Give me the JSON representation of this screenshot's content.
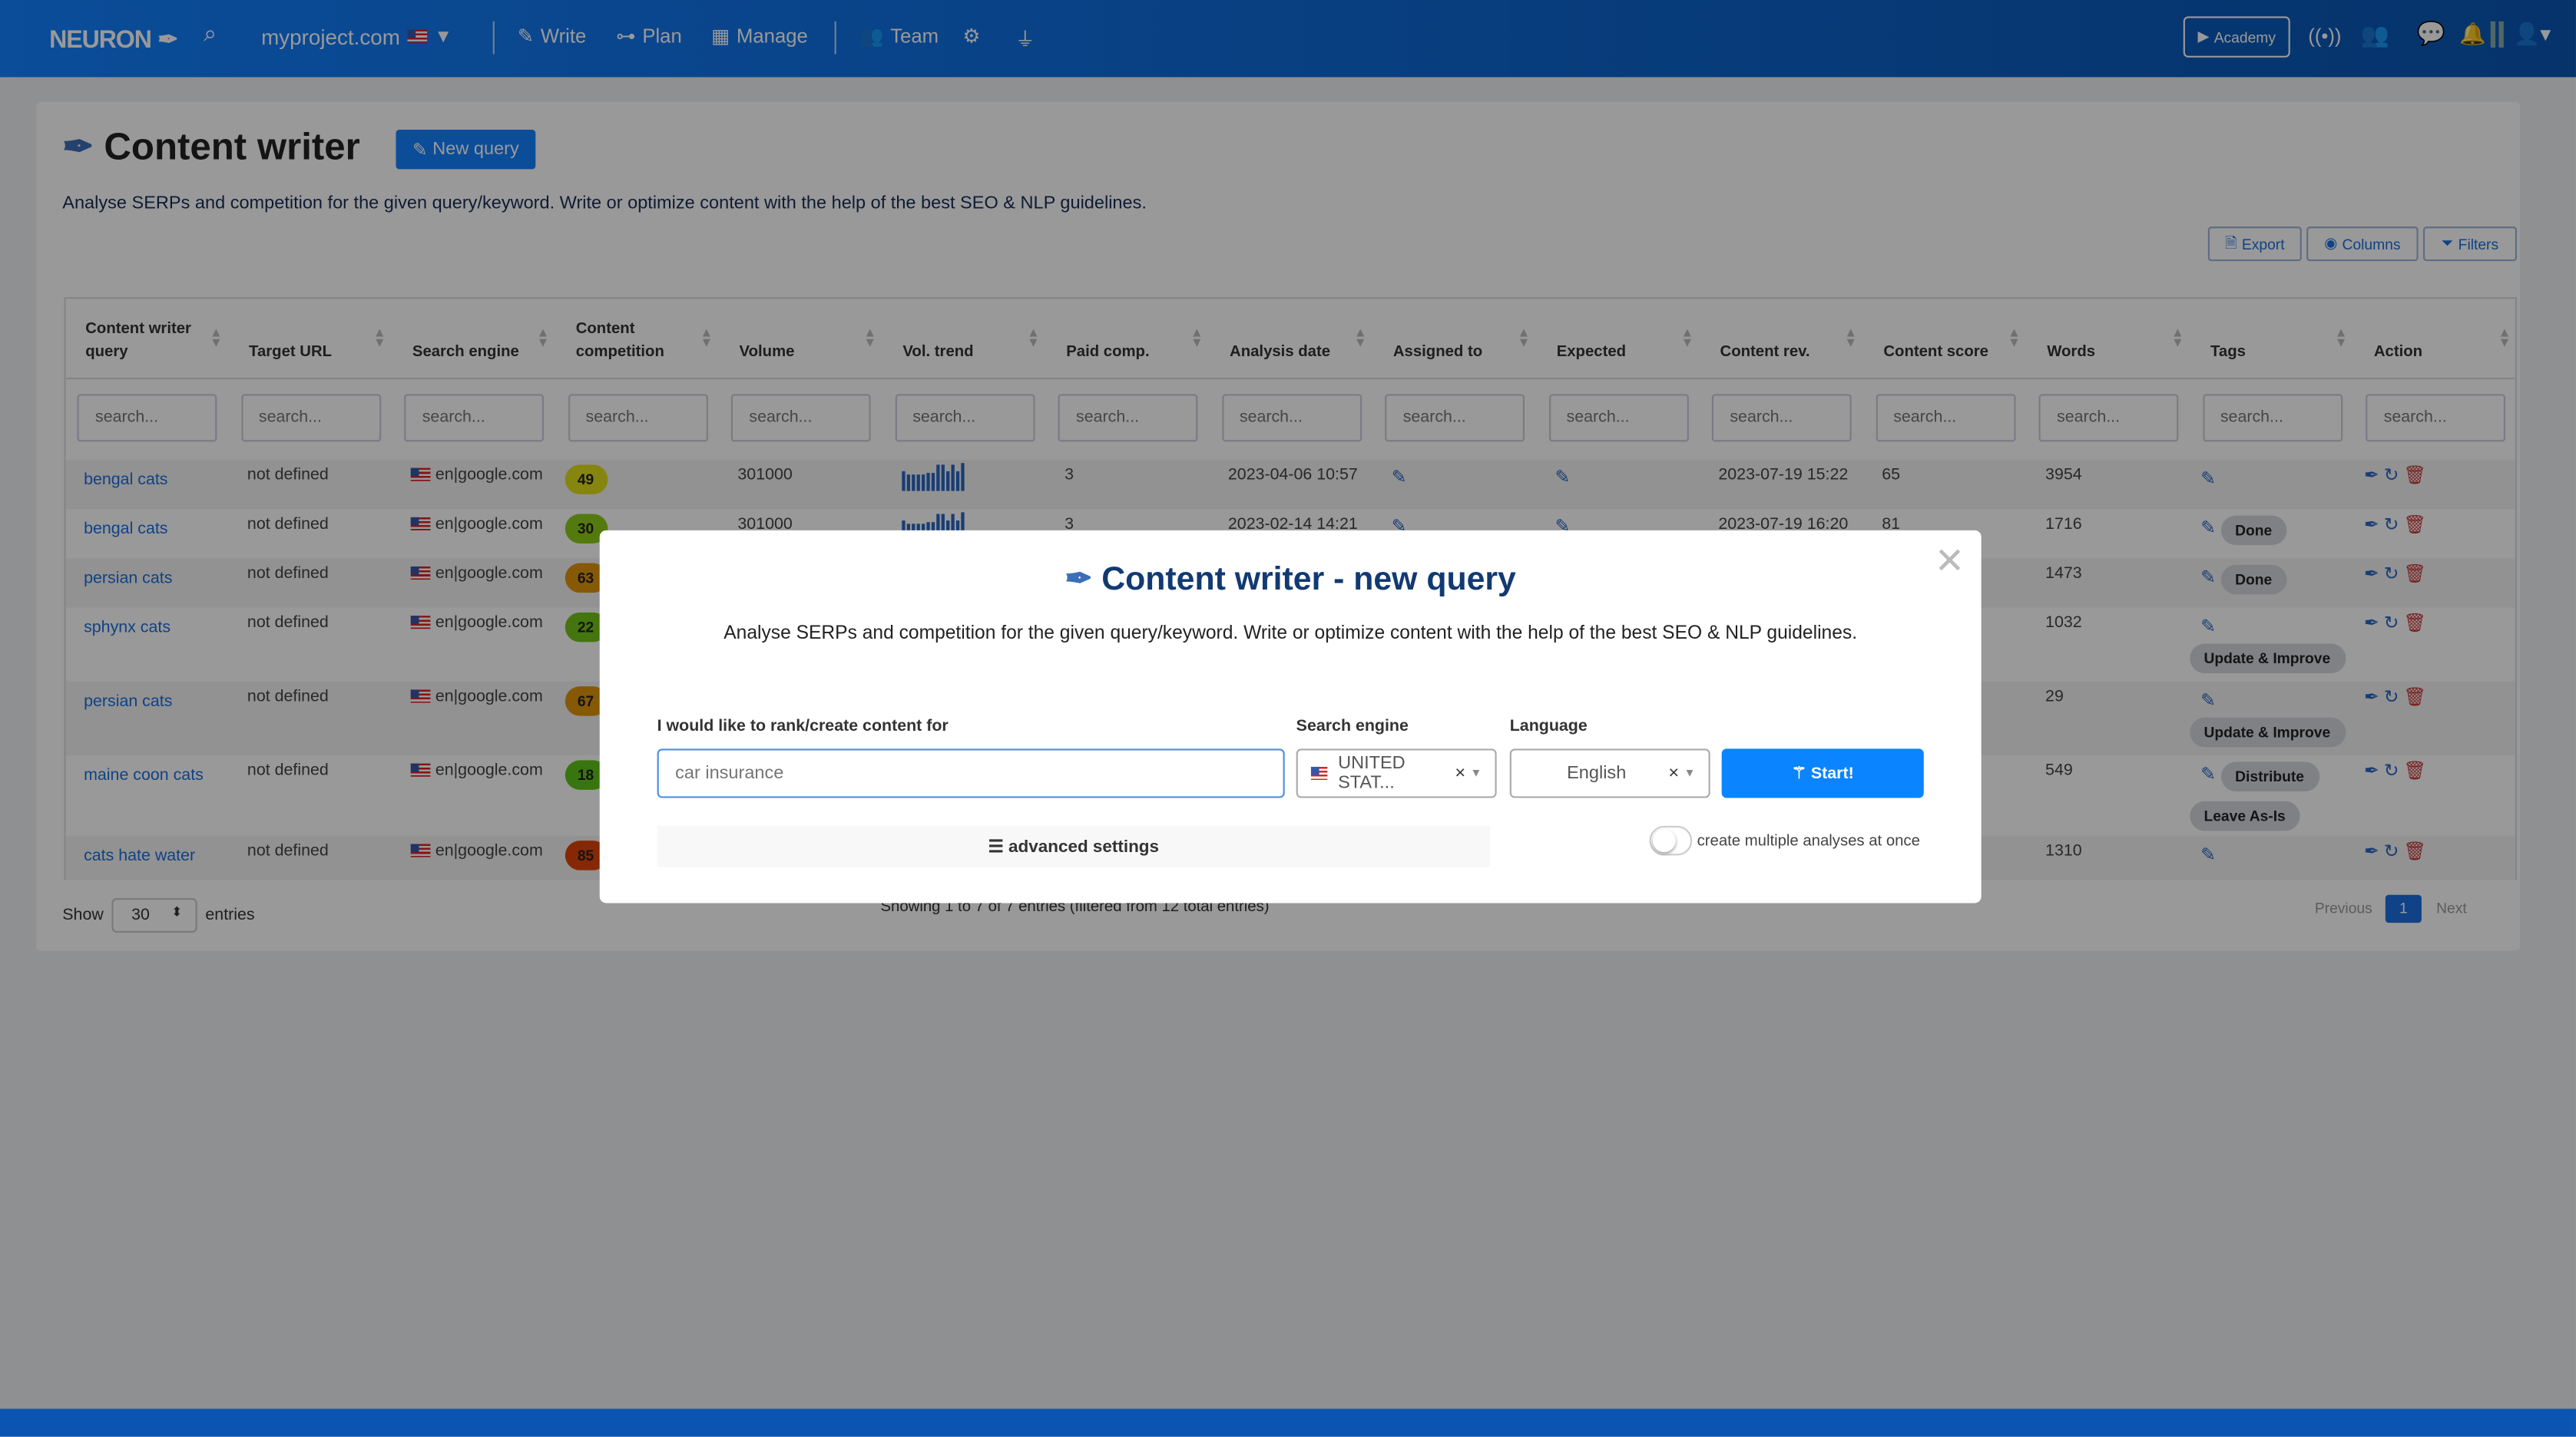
{
  "nav": {
    "logo": "NEURON",
    "project": "myproject.com",
    "write": "Write",
    "plan": "Plan",
    "manage": "Manage",
    "team": "Team",
    "academy": "Academy"
  },
  "page": {
    "title": "Content writer",
    "new_query": "New query",
    "description": "Analyse SERPs and competition for the given query/keyword. Write or optimize content with the help of the best SEO & NLP guidelines.",
    "export": "Export",
    "columns": "Columns",
    "filters": "Filters"
  },
  "table": {
    "headers": [
      "Content writer query",
      "Target URL",
      "Search engine",
      "Content competition",
      "Volume",
      "Vol. trend",
      "Paid comp.",
      "Analysis date",
      "Assigned to",
      "Expected",
      "Content rev.",
      "Content score",
      "Words",
      "Tags",
      "Action"
    ],
    "filter_placeholder": "search...",
    "vol_trend": [
      10,
      8,
      8,
      8,
      8,
      9,
      9,
      14,
      14,
      10,
      14,
      10,
      15
    ],
    "rows": [
      {
        "query": "bengal cats",
        "url": "not defined",
        "engine": "en|google.com",
        "competition": "49",
        "color": "#dede1a",
        "volume": "301000",
        "paid": "3",
        "date": "2023-04-06 10:57",
        "rev": "2023-07-19 15:22",
        "score": "65",
        "words": "3954",
        "tags": []
      },
      {
        "query": "bengal cats",
        "url": "not defined",
        "engine": "en|google.com",
        "competition": "30",
        "color": "#8ccc1a",
        "volume": "301000",
        "paid": "3",
        "date": "2023-02-14 14:21",
        "rev": "2023-07-19 16:20",
        "score": "81",
        "words": "1716",
        "tags": [
          "Done"
        ]
      },
      {
        "query": "persian cats",
        "url": "not defined",
        "engine": "en|google.com",
        "competition": "63",
        "color": "#e0950d",
        "words": "1473",
        "tags": [
          "Done"
        ]
      },
      {
        "query": "sphynx cats",
        "url": "not defined",
        "engine": "en|google.com",
        "competition": "22",
        "color": "#72c41a",
        "words": "1032",
        "tags": [
          "Update & Improve"
        ]
      },
      {
        "query": "persian cats",
        "url": "not defined",
        "engine": "en|google.com",
        "competition": "67",
        "color": "#e0950d",
        "words": "29",
        "tags": [
          "Update & Improve"
        ]
      },
      {
        "query": "maine coon cats",
        "url": "not defined",
        "engine": "en|google.com",
        "competition": "18",
        "color": "#5ec41a",
        "words": "549",
        "tags": [
          "Distribute",
          "Leave As-Is"
        ]
      },
      {
        "query": "cats hate water",
        "url": "not defined",
        "engine": "en|google.com",
        "competition": "85",
        "color": "#e0440b",
        "words": "1310",
        "tags": []
      }
    ],
    "show": "Show",
    "entries_value": "30",
    "entries": "entries",
    "info": "Showing 1 to 7 of 7 entries (filtered from 12 total entries)",
    "previous": "Previous",
    "page": "1",
    "next": "Next"
  },
  "modal": {
    "title": "Content writer - new query",
    "description": "Analyse SERPs and competition for the given query/keyword. Write or optimize content with the help of the best SEO & NLP guidelines.",
    "query_label": "I would like to rank/create content for",
    "query_placeholder": "car insurance",
    "engine_label": "Search engine",
    "engine_value": "UNITED STAT...",
    "language_label": "Language",
    "language_value": "English",
    "start": "Start!",
    "advanced": "advanced settings",
    "multiple": "create multiple analyses at once"
  }
}
